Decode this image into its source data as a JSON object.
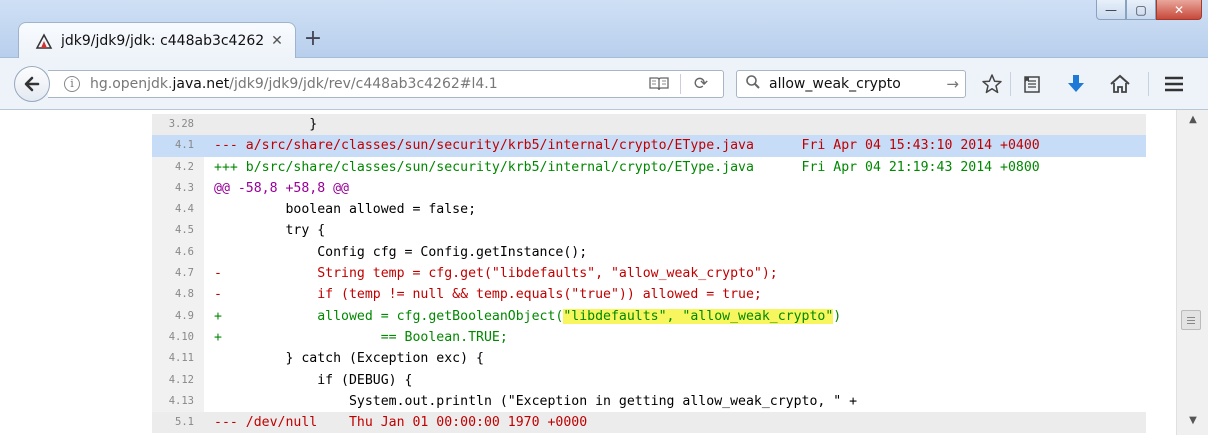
{
  "browser": {
    "tab": {
      "title": "jdk9/jdk9/jdk: c448ab3c4262",
      "close": "✕"
    },
    "new_tab": "+",
    "window_controls": {
      "minimize": "—",
      "maximize": "▢",
      "close": "✕"
    },
    "url": {
      "prefix": "hg.openjdk.",
      "domain": "java.net",
      "path": "/jdk9/jdk9/jdk/rev/c448ab3c4262#l4.1"
    },
    "search": {
      "value": "allow_weak_crypto",
      "go": "→"
    },
    "icons": [
      "back-icon",
      "info-icon",
      "reader-icon",
      "reload-icon",
      "search-icon",
      "bookmark-star-icon",
      "reading-list-icon",
      "download-icon",
      "home-icon",
      "menu-icon"
    ]
  },
  "diff": {
    "lines": [
      {
        "num": "3.28",
        "text": "            }",
        "kind": "context"
      },
      {
        "num": "4.1",
        "text": "--- a/src/share/classes/sun/security/krb5/internal/crypto/EType.java      Fri Apr 04 15:43:10 2014 +0400",
        "kind": "minus"
      },
      {
        "num": "4.2",
        "text": "+++ b/src/share/classes/sun/security/krb5/internal/crypto/EType.java      Fri Apr 04 21:19:43 2014 +0800",
        "kind": "plus"
      },
      {
        "num": "4.3",
        "text": "@@ -58,8 +58,8 @@",
        "kind": "at"
      },
      {
        "num": "4.4",
        "text": "         boolean allowed = false;",
        "kind": "context"
      },
      {
        "num": "4.5",
        "text": "         try {",
        "kind": "context"
      },
      {
        "num": "4.6",
        "text": "             Config cfg = Config.getInstance();",
        "kind": "context"
      },
      {
        "num": "4.7",
        "text": "-            String temp = cfg.get(\"libdefaults\", \"allow_weak_crypto\");",
        "kind": "minus"
      },
      {
        "num": "4.8",
        "text": "-            if (temp != null && temp.equals(\"true\")) allowed = true;",
        "kind": "minus"
      },
      {
        "num": "4.9",
        "pre": "+            allowed = cfg.getBooleanObject(",
        "highlight": "\"libdefaults\", \"allow_weak_crypto\"",
        "post": ")",
        "kind": "plus"
      },
      {
        "num": "4.10",
        "text": "+                    == Boolean.TRUE;",
        "kind": "plus"
      },
      {
        "num": "4.11",
        "text": "         } catch (Exception exc) {",
        "kind": "context"
      },
      {
        "num": "4.12",
        "text": "             if (DEBUG) {",
        "kind": "context"
      },
      {
        "num": "4.13",
        "text": "                 System.out.println (\"Exception in getting allow_weak_crypto, \" +",
        "kind": "context"
      },
      {
        "num": "5.1",
        "text": "--- /dev/null    Thu Jan 01 00:00:00 1970 +0000",
        "kind": "minus"
      }
    ]
  },
  "scrollbar": {
    "up": "▲",
    "down": "▼"
  }
}
